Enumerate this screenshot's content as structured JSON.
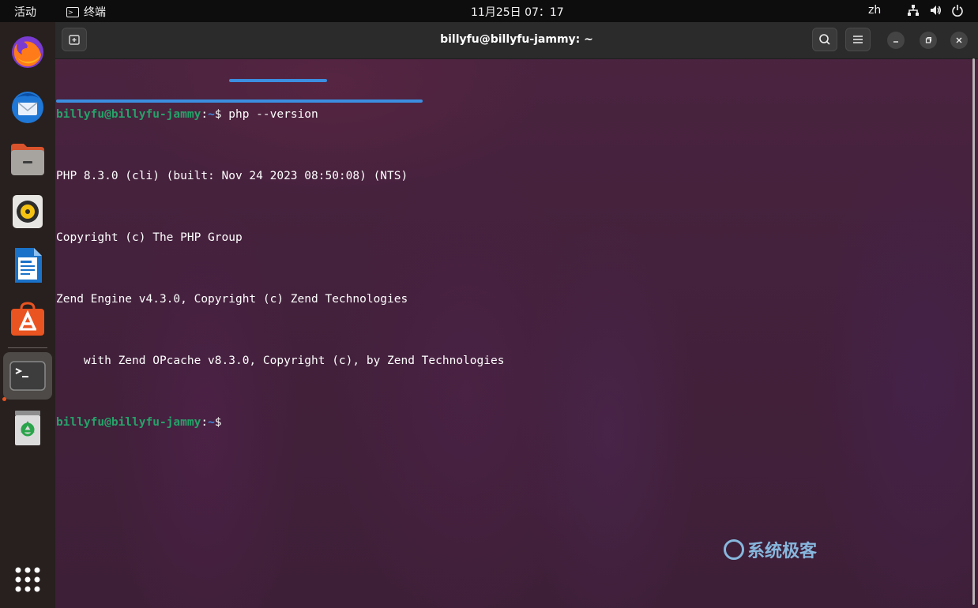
{
  "topbar": {
    "activities": "活动",
    "app_name": "终端",
    "clock": "11月25日  07：17",
    "language": "zh",
    "icons": [
      "network-icon",
      "volume-icon",
      "power-icon"
    ]
  },
  "dock": {
    "apps": [
      {
        "name": "Firefox",
        "icon": "firefox-icon"
      },
      {
        "name": "Thunderbird",
        "icon": "thunderbird-icon"
      },
      {
        "name": "Files",
        "icon": "files-icon"
      },
      {
        "name": "Rhythmbox",
        "icon": "rhythmbox-icon"
      },
      {
        "name": "LibreOffice Writer",
        "icon": "writer-icon"
      },
      {
        "name": "Ubuntu Software",
        "icon": "software-icon"
      },
      {
        "name": "Terminal",
        "icon": "terminal-icon"
      },
      {
        "name": "Trash",
        "icon": "trash-icon"
      }
    ],
    "show_apps_icon": "app-grid-icon"
  },
  "window": {
    "title": "billyfu@billyfu-jammy: ~"
  },
  "terminal": {
    "prompt_user": "billyfu@billyfu-jammy",
    "prompt_sep": ":",
    "prompt_path": "~",
    "prompt_symbol": "$ ",
    "command": "php --version",
    "output": [
      "PHP 8.3.0 (cli) (built: Nov 24 2023 08:50:08) (NTS)",
      "Copyright (c) The PHP Group",
      "Zend Engine v4.3.0, Copyright (c) Zend Technologies",
      "    with Zend OPcache v8.3.0, Copyright (c), by Zend Technologies"
    ]
  },
  "watermark": {
    "text": "系统极客"
  },
  "colors": {
    "prompt_user": "#26a269",
    "prompt_path": "#3c8ce4",
    "highlight": "#3b8ee0",
    "accent": "#e95420"
  }
}
